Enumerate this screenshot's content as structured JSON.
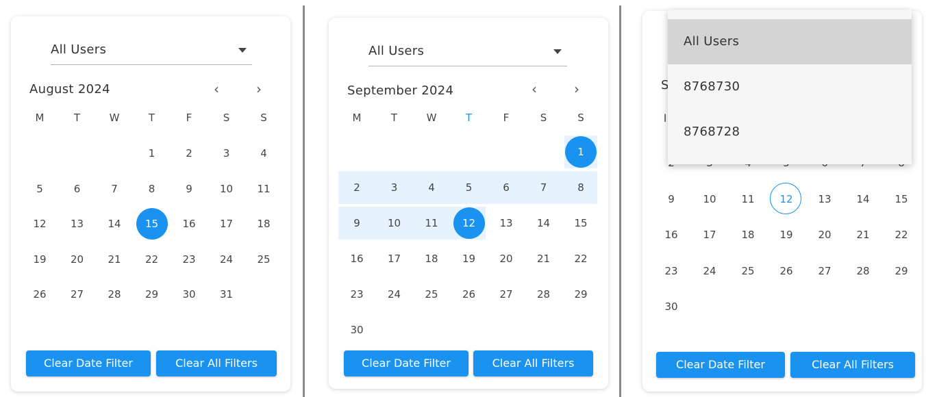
{
  "panels": [
    {
      "user_select": "All Users",
      "month": "August 2024",
      "prev_icon": "‹",
      "next_icon": "›",
      "weekdays": [
        "M",
        "T",
        "W",
        "T",
        "F",
        "S",
        "S"
      ],
      "buttons": {
        "clear_date": "Clear Date Filter",
        "clear_all": "Clear All Filters"
      }
    },
    {
      "user_select": "All Users",
      "month": "September 2024",
      "prev_icon": "‹",
      "next_icon": "›",
      "weekdays": [
        "M",
        "T",
        "W",
        "T",
        "F",
        "S",
        "S"
      ],
      "buttons": {
        "clear_date": "Clear Date Filter",
        "clear_all": "Clear All Filters"
      }
    },
    {
      "dropdown_options": [
        "All Users",
        "8768730",
        "8768728"
      ],
      "peek_letters": [
        "S",
        "l"
      ],
      "buttons": {
        "clear_date": "Clear Date Filter",
        "clear_all": "Clear All Filters"
      }
    }
  ],
  "calendars": [
    {
      "first_weekday": 3,
      "days": 31,
      "selected": 15,
      "range": [],
      "today": null
    },
    {
      "first_weekday": 6,
      "days": 30,
      "selected": 12,
      "range_start": 1,
      "today": null
    },
    {
      "first_weekday": 6,
      "days": 30,
      "selected": null,
      "today": 12
    }
  ],
  "accent": "#1a93f0"
}
